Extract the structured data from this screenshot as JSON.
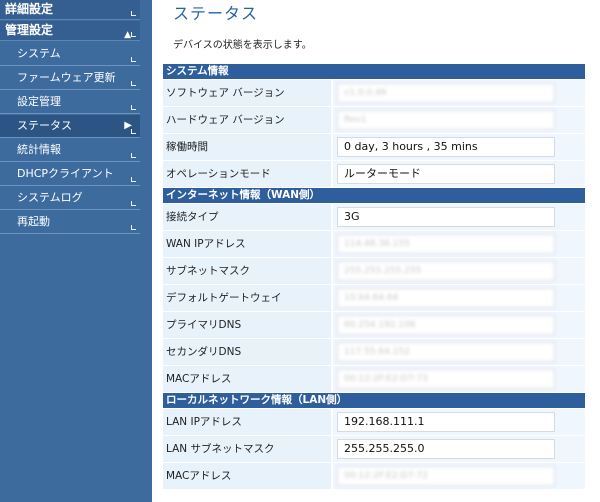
{
  "sidebar": {
    "top_items": [
      {
        "label": "詳細設定"
      },
      {
        "label": "管理設定"
      }
    ],
    "items": [
      {
        "label": "システム"
      },
      {
        "label": "ファームウェア更新"
      },
      {
        "label": "設定管理"
      },
      {
        "label": "ステータス"
      },
      {
        "label": "統計情報"
      },
      {
        "label": "DHCPクライアント"
      },
      {
        "label": "システムログ"
      },
      {
        "label": "再起動"
      }
    ]
  },
  "main": {
    "title": "ステータス",
    "description": "デバイスの状態を表示します。",
    "sections": [
      {
        "header": "システム情報",
        "rows": [
          {
            "label": "ソフトウェア バージョン",
            "value": "v1.0.0.46",
            "blurred": true
          },
          {
            "label": "ハードウェア バージョン",
            "value": "Rev1",
            "blurred": true
          },
          {
            "label": "稼働時間",
            "value": "0 day, 3 hours , 35 mins",
            "blurred": false
          },
          {
            "label": "オペレーションモード",
            "value": "ルーターモード",
            "blurred": false
          }
        ]
      },
      {
        "header": "インターネット情報（WAN側）",
        "rows": [
          {
            "label": "接続タイプ",
            "value": "3G",
            "blurred": false
          },
          {
            "label": "WAN IPアドレス",
            "value": "114.48.36.155",
            "blurred": true
          },
          {
            "label": "サブネットマスク",
            "value": "255.255.255.255",
            "blurred": true
          },
          {
            "label": "デフォルトゲートウェイ",
            "value": "10.64.64.64",
            "blurred": true
          },
          {
            "label": "プライマリDNS",
            "value": "60.254.192.106",
            "blurred": true
          },
          {
            "label": "セカンダリDNS",
            "value": "117.55.64.152",
            "blurred": true
          },
          {
            "label": "MACアドレス",
            "value": "00:12:2F:E2:D7:73",
            "blurred": true
          }
        ]
      },
      {
        "header": "ローカルネットワーク情報（LAN側）",
        "rows": [
          {
            "label": "LAN IPアドレス",
            "value": "192.168.111.1",
            "blurred": false
          },
          {
            "label": "LAN サブネットマスク",
            "value": "255.255.255.0",
            "blurred": false
          },
          {
            "label": "MACアドレス",
            "value": "00:12:2F:E2:D7:72",
            "blurred": true
          }
        ]
      }
    ]
  },
  "colors": {
    "sidebar_bg": "#3d6b9e",
    "section_header_bg": "#2f5e9d",
    "label_bg": "#e7f2fb",
    "title": "#2860a8"
  }
}
